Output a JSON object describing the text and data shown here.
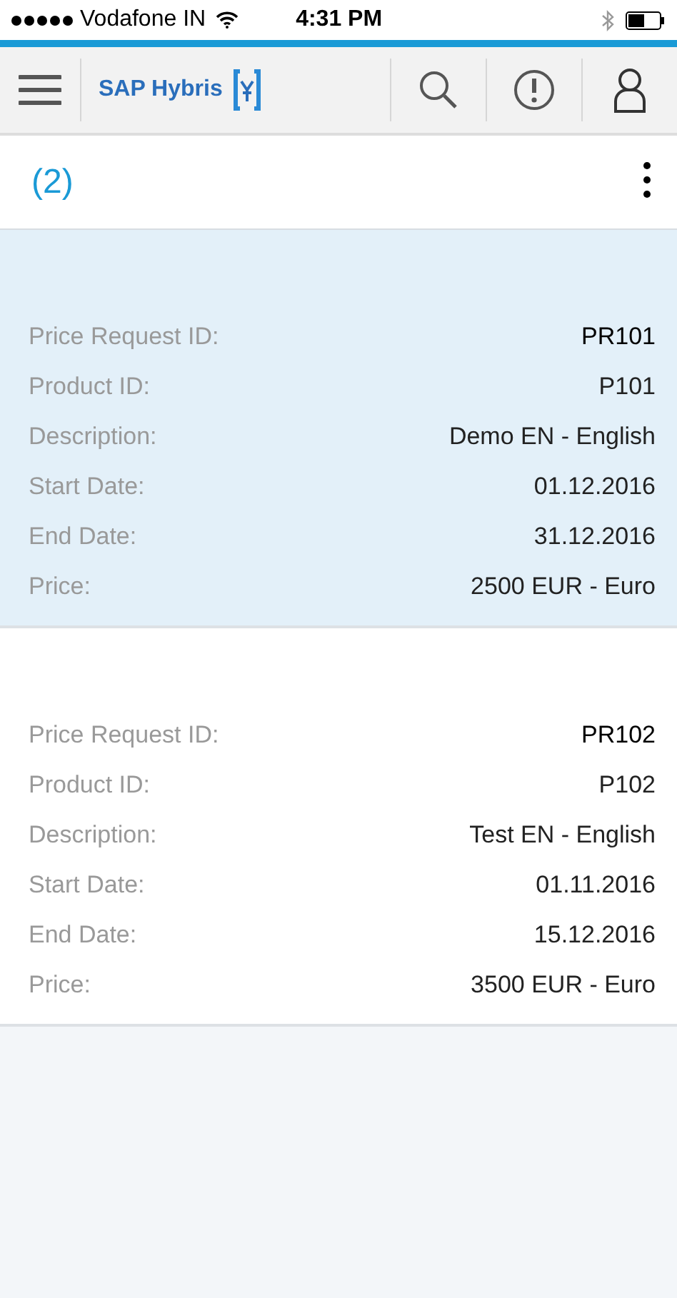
{
  "status_bar": {
    "carrier": "Vodafone IN",
    "time": "4:31 PM"
  },
  "header": {
    "brand": "SAP Hybris"
  },
  "list": {
    "count": "(2)"
  },
  "items": [
    {
      "selected": true,
      "fields": [
        {
          "label": "Price Request ID:",
          "value": "PR101"
        },
        {
          "label": "Product ID:",
          "value": "P101"
        },
        {
          "label": "Description:",
          "value": "Demo EN - English"
        },
        {
          "label": "Start Date:",
          "value": "01.12.2016"
        },
        {
          "label": "End Date:",
          "value": "31.12.2016"
        },
        {
          "label": "Price:",
          "value": "2500 EUR - Euro"
        }
      ]
    },
    {
      "selected": false,
      "fields": [
        {
          "label": "Price Request ID:",
          "value": "PR102"
        },
        {
          "label": "Product ID:",
          "value": "P102"
        },
        {
          "label": "Description:",
          "value": "Test EN - English"
        },
        {
          "label": "Start Date:",
          "value": "01.11.2016"
        },
        {
          "label": "End Date:",
          "value": "15.12.2016"
        },
        {
          "label": "Price:",
          "value": "3500 EUR - Euro"
        }
      ]
    }
  ]
}
